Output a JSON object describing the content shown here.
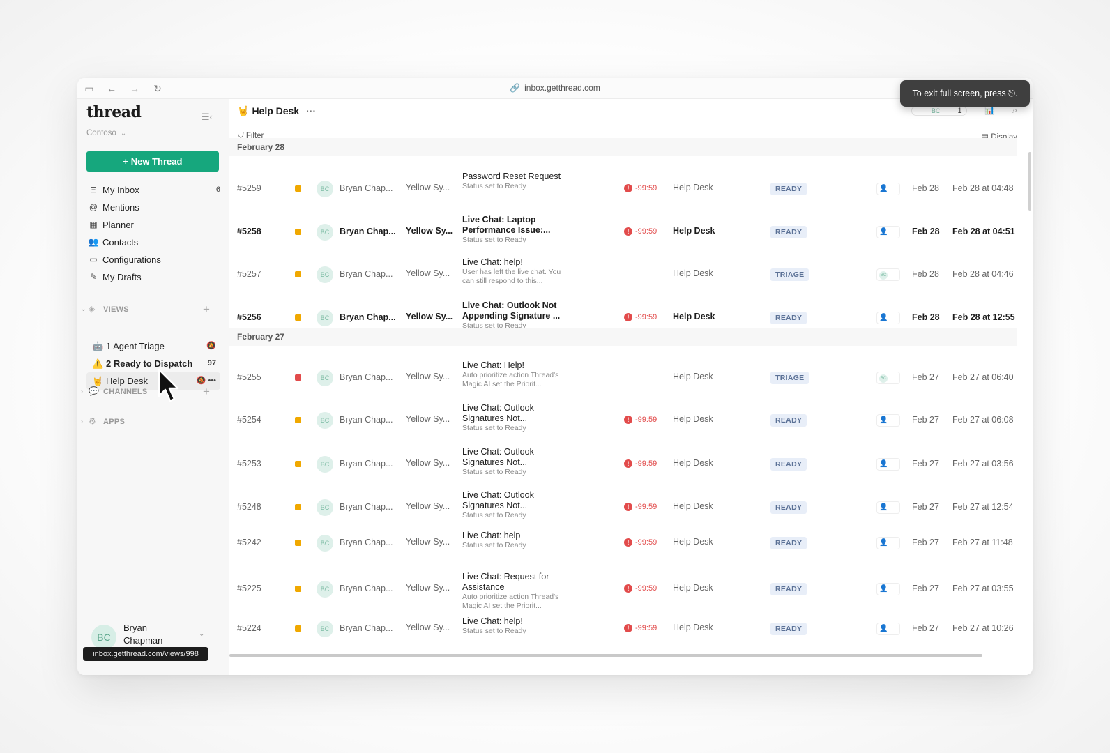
{
  "browser": {
    "url": "inbox.getthread.com",
    "toast": "To exit full screen, press ⎋."
  },
  "sidebar": {
    "brand": "thread",
    "org": "Contoso",
    "new_thread": "+ New Thread",
    "nav": [
      {
        "label": "My Inbox",
        "count": "6",
        "icon": "inbox-icon"
      },
      {
        "label": "Mentions",
        "count": "",
        "icon": "at-icon"
      },
      {
        "label": "Planner",
        "count": "",
        "icon": "planner-icon"
      },
      {
        "label": "Contacts",
        "count": "",
        "icon": "contacts-icon"
      },
      {
        "label": "Configurations",
        "count": "",
        "icon": "monitor-icon"
      },
      {
        "label": "My Drafts",
        "count": "",
        "icon": "pencil-icon"
      }
    ],
    "views_label": "VIEWS",
    "views": [
      {
        "label": "1 Agent Triage",
        "emoji": "🤖",
        "tail": "🔕"
      },
      {
        "label": "2 Ready to Dispatch",
        "emoji": "⚠️",
        "tail": "97"
      },
      {
        "label": "Help Desk",
        "emoji": "🤘",
        "tail": "🔕 •••"
      }
    ],
    "channels_label": "CHANNELS",
    "apps_label": "APPS",
    "user": {
      "initials": "BC",
      "name": "Bryan Chapman"
    },
    "status_url": "inbox.getthread.com/views/998"
  },
  "main": {
    "title": "Help Desk",
    "title_emoji": "🤘",
    "top_count": "1",
    "avatar_initials": "BC",
    "filter_label": "Filter",
    "display_label": "Display",
    "groups": [
      {
        "label": "February 28",
        "rows": [
          {
            "id": "#5259",
            "pri": "orange",
            "av": "BC",
            "customer": "Bryan Chap...",
            "org": "Yellow Sy...",
            "title": "Password Reset Request",
            "sub": "Status set to Ready",
            "sla": "-99:59",
            "queue": "Help Desk",
            "status": "READY",
            "assignee": "person",
            "d1": "Feb 28",
            "d2": "Feb 28 at 04:48",
            "bold": false
          },
          {
            "id": "#5258",
            "pri": "orange",
            "av": "BC",
            "customer": "Bryan Chap...",
            "org": "Yellow Sy...",
            "title": "Live Chat: Laptop Performance Issue:...",
            "sub": "Status set to Ready",
            "sla": "-99:59",
            "queue": "Help Desk",
            "status": "READY",
            "assignee": "person",
            "d1": "Feb 28",
            "d2": "Feb 28 at 04:51",
            "bold": true
          },
          {
            "id": "#5257",
            "pri": "orange",
            "av": "BC",
            "customer": "Bryan Chap...",
            "org": "Yellow Sy...",
            "title": "Live Chat: help!",
            "sub": "User has left the live chat. You can still respond to this...",
            "sla": "",
            "queue": "Help Desk",
            "status": "TRIAGE",
            "assignee": "bc",
            "d1": "Feb 28",
            "d2": "Feb 28 at 04:46",
            "bold": false
          },
          {
            "id": "#5256",
            "pri": "orange",
            "av": "BC",
            "customer": "Bryan Chap...",
            "org": "Yellow Sy...",
            "title": "Live Chat: Outlook Not Appending Signature ...",
            "sub": "Status set to Ready",
            "sla": "-99:59",
            "queue": "Help Desk",
            "status": "READY",
            "assignee": "person",
            "d1": "Feb 28",
            "d2": "Feb 28 at 12:55",
            "bold": true
          }
        ]
      },
      {
        "label": "February 27",
        "rows": [
          {
            "id": "#5255",
            "pri": "red",
            "av": "BC",
            "customer": "Bryan Chap...",
            "org": "Yellow Sy...",
            "title": "Live Chat: Help!",
            "sub": "Auto prioritize action Thread's Magic AI set the Priorit...",
            "sla": "",
            "queue": "Help Desk",
            "status": "TRIAGE",
            "assignee": "bc",
            "d1": "Feb 27",
            "d2": "Feb 27 at 06:40",
            "bold": false
          },
          {
            "id": "#5254",
            "pri": "orange",
            "av": "BC",
            "customer": "Bryan Chap...",
            "org": "Yellow Sy...",
            "title": "Live Chat: Outlook Signatures Not...",
            "sub": "Status set to Ready",
            "sla": "-99:59",
            "queue": "Help Desk",
            "status": "READY",
            "assignee": "person",
            "d1": "Feb 27",
            "d2": "Feb 27 at 06:08",
            "bold": false
          },
          {
            "id": "#5253",
            "pri": "orange",
            "av": "BC",
            "customer": "Bryan Chap...",
            "org": "Yellow Sy...",
            "title": "Live Chat: Outlook Signatures Not...",
            "sub": "Status set to Ready",
            "sla": "-99:59",
            "queue": "Help Desk",
            "status": "READY",
            "assignee": "person",
            "d1": "Feb 27",
            "d2": "Feb 27 at 03:56",
            "bold": false
          },
          {
            "id": "#5248",
            "pri": "orange",
            "av": "BC",
            "customer": "Bryan Chap...",
            "org": "Yellow Sy...",
            "title": "Live Chat: Outlook Signatures Not...",
            "sub": "Status set to Ready",
            "sla": "-99:59",
            "queue": "Help Desk",
            "status": "READY",
            "assignee": "person",
            "d1": "Feb 27",
            "d2": "Feb 27 at 12:54",
            "bold": false
          },
          {
            "id": "#5242",
            "pri": "orange",
            "av": "BC",
            "customer": "Bryan Chap...",
            "org": "Yellow Sy...",
            "title": "Live Chat: help",
            "sub": "Status set to Ready",
            "sla": "-99:59",
            "queue": "Help Desk",
            "status": "READY",
            "assignee": "person",
            "d1": "Feb 27",
            "d2": "Feb 27 at 11:48",
            "bold": false
          },
          {
            "id": "#5225",
            "pri": "orange",
            "av": "BC",
            "customer": "Bryan Chap...",
            "org": "Yellow Sy...",
            "title": "Live Chat: Request for Assistance",
            "sub": "Auto prioritize action Thread's Magic AI set the Priorit...",
            "sla": "-99:59",
            "queue": "Help Desk",
            "status": "READY",
            "assignee": "person",
            "d1": "Feb 27",
            "d2": "Feb 27 at 03:55",
            "bold": false
          },
          {
            "id": "#5224",
            "pri": "orange",
            "av": "BC",
            "customer": "Bryan Chap...",
            "org": "Yellow Sy...",
            "title": "Live Chat: help!",
            "sub": "Status set to Ready",
            "sla": "-99:59",
            "queue": "Help Desk",
            "status": "READY",
            "assignee": "person",
            "d1": "Feb 27",
            "d2": "Feb 27 at 10:26",
            "bold": false
          }
        ]
      }
    ]
  }
}
